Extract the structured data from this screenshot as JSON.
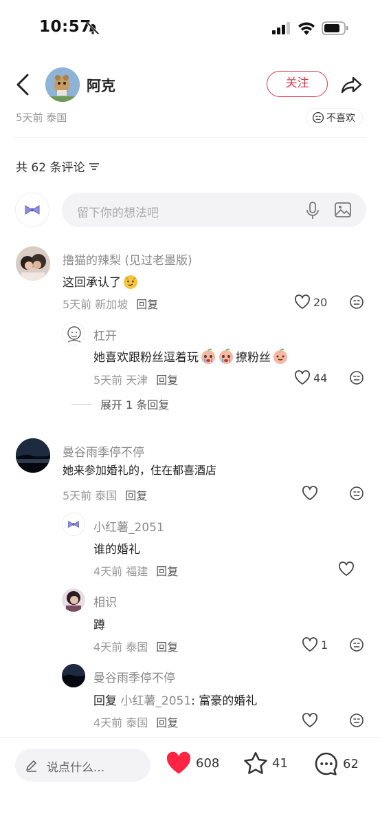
{
  "status": {
    "time": "10:57"
  },
  "header": {
    "author": "阿克",
    "follow": "关注"
  },
  "post": {
    "meta": "5天前 泰国",
    "dislike": "不喜欢"
  },
  "comments_header": {
    "count_label": "共 62 条评论"
  },
  "input": {
    "placeholder": "留下你的想法吧"
  },
  "comments": [
    {
      "name": "撸猫的辣梨 (见过老墨版)",
      "text": "这回承认了",
      "meta": "5天前 新加坡",
      "reply": "回复",
      "likes": "20"
    },
    {
      "name": "杠开",
      "text_a": "她喜欢跟粉丝逗着玩",
      "text_b": "撩粉丝",
      "meta": "5天前 天津",
      "reply": "回复",
      "likes": "44"
    },
    {
      "name": "曼谷雨季停不停",
      "text": "她来参加婚礼的，住在都喜酒店",
      "meta": "5天前 泰国",
      "reply": "回复",
      "likes": ""
    },
    {
      "name": "小红薯_2051",
      "text": "谁的婚礼",
      "meta": "4天前 福建",
      "reply": "回复",
      "likes": ""
    },
    {
      "name": "相识",
      "text": "蹲",
      "meta": "4天前 泰国",
      "reply": "回复",
      "likes": "1"
    },
    {
      "name": "曼谷雨季停不停",
      "reply_prefix": "回复",
      "reply_to": "小红薯_2051",
      "text": ": 富豪的婚礼",
      "meta": "4天前 泰国",
      "reply": "回复",
      "likes": ""
    }
  ],
  "expand": {
    "label": "展开 1 条回复"
  },
  "bottom": {
    "placeholder": "说点什么...",
    "likes": "608",
    "favorites": "41",
    "comments": "62"
  },
  "colors": {
    "accent": "#e0364b",
    "like_red": "#ff2442"
  }
}
